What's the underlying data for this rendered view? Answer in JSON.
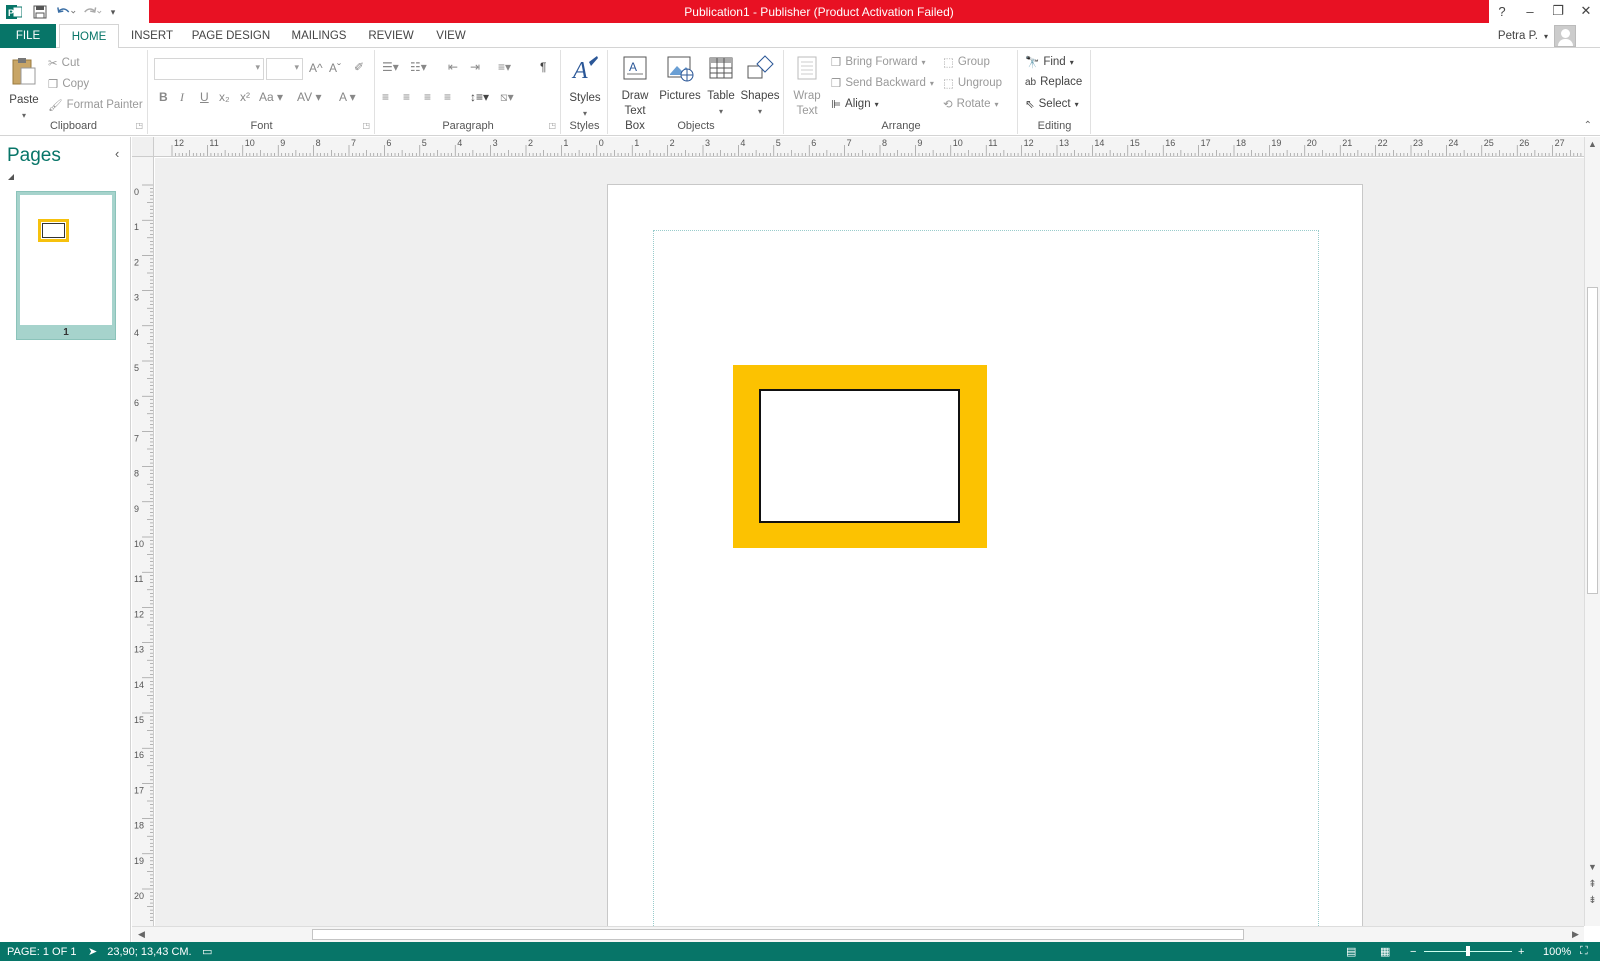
{
  "window": {
    "title": "Publication1 -  Publisher (Product Activation Failed)",
    "title_bar_color": "#e81123"
  },
  "qat": {
    "items": [
      "publisher-logo-icon",
      "save-icon",
      "undo-icon",
      "redo-icon",
      "customize-qat-icon"
    ]
  },
  "win_controls": {
    "help": "?",
    "minimize": "–",
    "restore": "❐",
    "close": "✕"
  },
  "tabs": {
    "file": "FILE",
    "home": "HOME",
    "insert": "INSERT",
    "page_design": "PAGE DESIGN",
    "mailings": "MAILINGS",
    "review": "REVIEW",
    "view": "VIEW",
    "accent": "#077568"
  },
  "user": {
    "name": "Petra P."
  },
  "ribbon": {
    "clipboard": {
      "label": "Clipboard",
      "paste": "Paste",
      "cut": "Cut",
      "copy": "Copy",
      "format_painter": "Format Painter"
    },
    "font": {
      "label": "Font",
      "bold": "B",
      "italic": "I",
      "underline": "U",
      "subscript": "x₂",
      "superscript": "x²",
      "change_case": "Aa",
      "grow": "A^",
      "shrink": "Aˇ",
      "font_color": "A"
    },
    "paragraph": {
      "label": "Paragraph",
      "pilcrow": "¶"
    },
    "styles": {
      "label": "Styles",
      "button": "Styles"
    },
    "objects": {
      "label": "Objects",
      "draw_text_box_1": "Draw",
      "draw_text_box_2": "Text Box",
      "pictures": "Pictures",
      "table": "Table",
      "shapes": "Shapes"
    },
    "arrange": {
      "label": "Arrange",
      "wrap_text_1": "Wrap",
      "wrap_text_2": "Text",
      "bring_forward": "Bring Forward",
      "send_backward": "Send Backward",
      "align": "Align",
      "group": "Group",
      "ungroup": "Ungroup",
      "rotate": "Rotate"
    },
    "editing": {
      "label": "Editing",
      "find": "Find",
      "replace": "Replace",
      "select": "Select"
    }
  },
  "pages_pane": {
    "title": "Pages",
    "collapse": "‹",
    "thumbnail_number": "1"
  },
  "rulers": {
    "horizontal": [
      "12",
      "11",
      "10",
      "9",
      "8",
      "7",
      "6",
      "5",
      "4",
      "3",
      "2",
      "1",
      "0",
      "1",
      "2",
      "3",
      "4",
      "5",
      "6",
      "7",
      "8",
      "9",
      "10",
      "11",
      "12",
      "13",
      "14",
      "15",
      "16",
      "17",
      "18",
      "19",
      "20",
      "21",
      "22",
      "23",
      "24",
      "25",
      "26",
      "27"
    ],
    "vertical": [
      "0",
      "1",
      "2",
      "3",
      "4",
      "5",
      "6",
      "7",
      "8",
      "9",
      "10",
      "11",
      "12",
      "13",
      "14",
      "15",
      "16",
      "17",
      "18",
      "19",
      "20"
    ]
  },
  "document": {
    "shape_fill": "#fcc201",
    "shape_border": "#111111"
  },
  "status": {
    "page": "PAGE: 1 OF 1",
    "position": "23,90; 13,43 CM.",
    "zoom": "100%"
  }
}
